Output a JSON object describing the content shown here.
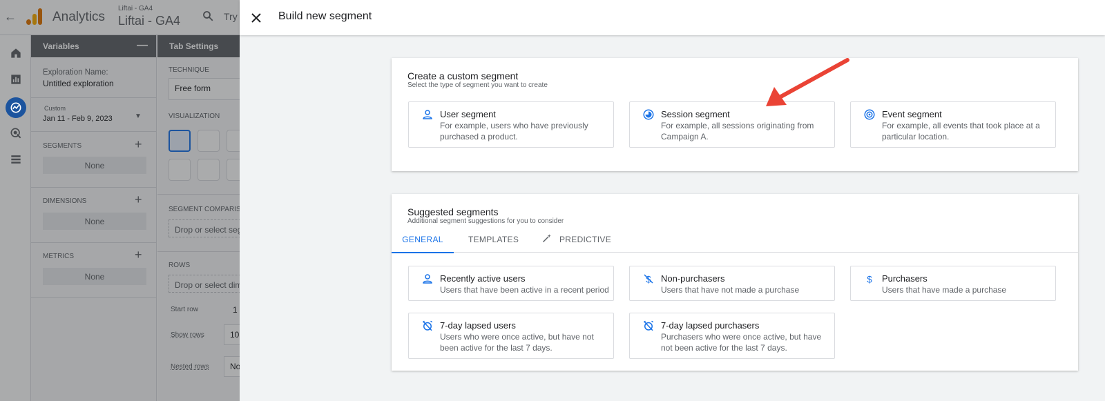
{
  "background_app": {
    "app_name": "Analytics",
    "account_small": "Liftai - GA4",
    "account_big": "Liftai - GA4",
    "search_placeholder": "Try s",
    "variables_panel": {
      "title": "Variables",
      "exploration_name_label": "Exploration Name:",
      "exploration_name_value": "Untitled exploration",
      "date_label": "Custom",
      "date_value": "Jan 11 - Feb 9, 2023",
      "segments_label": "SEGMENTS",
      "segments_value": "None",
      "dimensions_label": "DIMENSIONS",
      "dimensions_value": "None",
      "metrics_label": "METRICS",
      "metrics_value": "None"
    },
    "tab_settings_panel": {
      "title": "Tab Settings",
      "technique_label": "TECHNIQUE",
      "technique_value": "Free form",
      "visualization_label": "VISUALIZATION",
      "segment_comparison_label": "SEGMENT COMPARISO",
      "segment_drop_text": "Drop or select seg",
      "rows_label": "ROWS",
      "rows_drop_text": "Drop or select dim",
      "start_row_label": "Start row",
      "start_row_value": "1",
      "show_rows_label": "Show rows",
      "show_rows_value": "10",
      "nested_rows_label": "Nested rows",
      "nested_rows_value": "No"
    }
  },
  "drawer": {
    "title": "Build new segment",
    "custom_card": {
      "title": "Create a custom segment",
      "subtitle": "Select the type of segment you want to create",
      "options": [
        {
          "title": "User segment",
          "description": "For example, users who have previously purchased a product.",
          "icon": "person-icon"
        },
        {
          "title": "Session segment",
          "description": "For example, all sessions originating from Campaign A.",
          "icon": "session-icon"
        },
        {
          "title": "Event segment",
          "description": "For example, all events that took place at a particular location.",
          "icon": "event-icon"
        }
      ]
    },
    "suggested_card": {
      "title": "Suggested segments",
      "subtitle": "Additional segment suggestions for you to consider",
      "tabs": [
        "GENERAL",
        "TEMPLATES",
        "PREDICTIVE"
      ],
      "active_tab": "GENERAL",
      "options": [
        {
          "title": "Recently active users",
          "description": "Users that have been active in a recent period",
          "icon": "person-icon"
        },
        {
          "title": "Non-purchasers",
          "description": "Users that have not made a purchase",
          "icon": "no-dollar-icon"
        },
        {
          "title": "Purchasers",
          "description": "Users that have made a purchase",
          "icon": "dollar-icon"
        },
        {
          "title": "7-day lapsed users",
          "description": "Users who were once active, but have not been active for the last 7 days.",
          "icon": "alarm-off-icon"
        },
        {
          "title": "7-day lapsed purchasers",
          "description": "Purchasers who were once active, but have not been active for the last 7 days.",
          "icon": "alarm-off-icon"
        }
      ]
    },
    "accent_color": "#1a73e8",
    "annotation_color": "#ea4335"
  }
}
